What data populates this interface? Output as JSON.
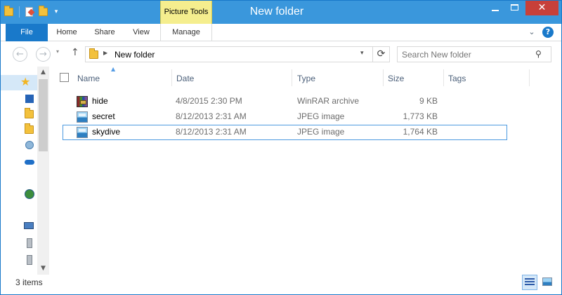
{
  "window": {
    "title": "New folder",
    "context_tab_group": "Picture Tools",
    "minimize_glyph": "–",
    "maximize_glyph": "□",
    "close_glyph": "✕"
  },
  "quick_access_toolbar": {
    "icons": [
      "folder-icon",
      "properties-icon",
      "new-folder-icon"
    ],
    "dropdown_glyph": "▾"
  },
  "ribbon": {
    "file_tab": "File",
    "tabs": [
      {
        "label": "Home"
      },
      {
        "label": "Share"
      },
      {
        "label": "View"
      },
      {
        "label": "Manage"
      }
    ],
    "expand_glyph": "⌄",
    "help_glyph": "?"
  },
  "navigation": {
    "back_glyph": "←",
    "forward_glyph": "→",
    "recent_glyph": "▾",
    "up_glyph": "↑",
    "address_path": "New folder",
    "path_chevron": "▶",
    "address_dropdown": "▾",
    "refresh_glyph": "⟳",
    "search_placeholder": "Search New folder",
    "search_glyph": "⚲"
  },
  "nav_pane": {
    "scroll_up": "▲",
    "scroll_down": "▼",
    "items": [
      "favorites-star-icon",
      "desktop-icon",
      "downloads-folder-icon",
      "recent-places-icon",
      "homegroup-icon",
      "onedrive-icon",
      "network-icon",
      "computer-icon",
      "drive-icon",
      "drive-icon-2"
    ]
  },
  "columns": {
    "name": "Name",
    "date": "Date",
    "type": "Type",
    "size": "Size",
    "tags": "Tags"
  },
  "files": [
    {
      "name": "hide",
      "date": "4/8/2015 2:30 PM",
      "type": "WinRAR archive",
      "size": "9 KB",
      "icon": "winrar-archive-icon"
    },
    {
      "name": "secret",
      "date": "8/12/2013 2:31 AM",
      "type": "JPEG image",
      "size": "1,773 KB",
      "icon": "jpeg-image-icon"
    },
    {
      "name": "skydive",
      "date": "8/12/2013 2:31 AM",
      "type": "JPEG image",
      "size": "1,764 KB",
      "icon": "jpeg-image-icon"
    }
  ],
  "status": {
    "item_count": "3 items"
  },
  "colors": {
    "titlebar": "#3a97dc",
    "file_tab": "#1979ca",
    "picture_tools": "#f5ee8e",
    "close_button": "#c7403a",
    "selection_border": "#4c9ae0"
  }
}
